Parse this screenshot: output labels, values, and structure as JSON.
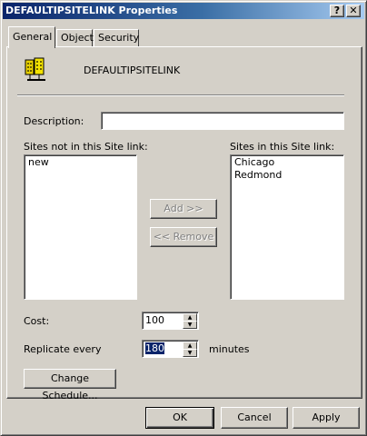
{
  "window": {
    "title": "DEFAULTIPSITELINK Properties",
    "help_glyph": "?",
    "close_glyph": "✕"
  },
  "tabs": [
    {
      "label": "General"
    },
    {
      "label": "Object"
    },
    {
      "label": "Security"
    }
  ],
  "general": {
    "object_icon": "site-link-icon",
    "object_name": "DEFAULTIPSITELINK",
    "description_label": "Description:",
    "description_value": "",
    "sites_not_label": "Sites not in this Site link:",
    "sites_not_items": [
      "new"
    ],
    "sites_in_label": "Sites in this Site link:",
    "sites_in_items": [
      "Chicago",
      "Redmond"
    ],
    "add_button": "Add >>",
    "remove_button": "<< Remove",
    "cost_label": "Cost:",
    "cost_value": "100",
    "replicate_label": "Replicate every",
    "replicate_value": "180",
    "minutes_label": "minutes",
    "change_schedule_button": "Change Schedule..."
  },
  "footer": {
    "ok": "OK",
    "cancel": "Cancel",
    "apply": "Apply"
  }
}
